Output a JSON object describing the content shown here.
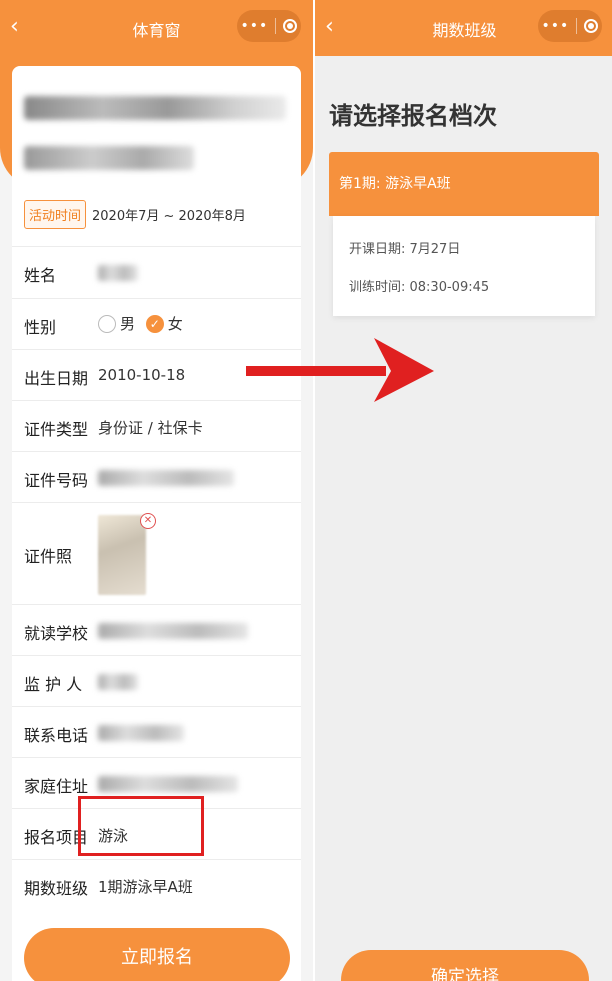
{
  "left": {
    "nav_title": "体育窗",
    "time_tag": "活动时间",
    "time_range": "2020年7月 ~ 2020年8月",
    "fields": {
      "name_label": "姓名",
      "gender_label": "性别",
      "gender_male": "男",
      "gender_female": "女",
      "birth_label": "出生日期",
      "birth_value": "2010-10-18",
      "id_type_label": "证件类型",
      "id_type_value": "身份证 / 社保卡",
      "id_number_label": "证件号码",
      "id_photo_label": "证件照",
      "school_label": "就读学校",
      "guardian_label": "监 护 人",
      "phone_label": "联系电话",
      "address_label": "家庭住址",
      "project_label": "报名项目",
      "project_value": "游泳",
      "class_label": "期数班级",
      "class_value": "1期游泳早A班"
    },
    "submit_label": "立即报名"
  },
  "right": {
    "nav_title": "期数班级",
    "heading": "请选择报名档次",
    "option_title": "第1期: 游泳早A班",
    "start_date": "开课日期:  7月27日",
    "train_time": "训练时间:  08:30-09:45",
    "confirm_label": "确定选择"
  },
  "icons": {
    "back": "back-chevron-icon",
    "more": "more-dots-icon",
    "close": "close-circle-icon",
    "arrow": "red-arrow-icon",
    "remove": "remove-photo-icon"
  },
  "colors": {
    "accent": "#f6913d",
    "highlight": "#e02020"
  }
}
